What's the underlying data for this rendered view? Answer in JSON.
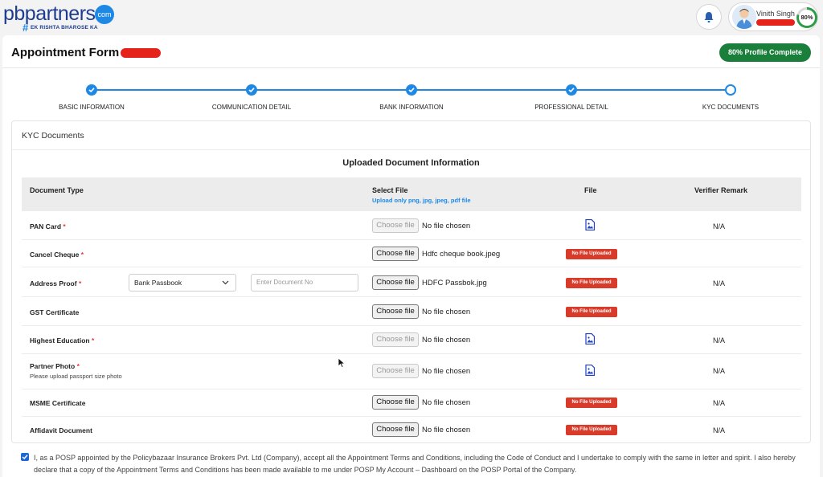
{
  "header": {
    "logo_main": "pbpartners",
    "logo_com": "com",
    "logo_tagline": "EK RISHTA BHAROSE KA",
    "user_name": "Vinith Singh",
    "profile_percent": "80%"
  },
  "form": {
    "title": "Appointment Form",
    "profile_button": "80% Profile Complete"
  },
  "steps": [
    {
      "label": "BASIC INFORMATION",
      "done": true
    },
    {
      "label": "COMMUNICATION DETAIL",
      "done": true
    },
    {
      "label": "BANK INFORMATION",
      "done": true
    },
    {
      "label": "PROFESSIONAL DETAIL",
      "done": true
    },
    {
      "label": "KYC DOCUMENTS",
      "done": false
    }
  ],
  "kyc": {
    "panel_title": "KYC Documents",
    "section_title": "Uploaded Document Information",
    "columns": {
      "document_type": "Document Type",
      "select_file": "Select File",
      "select_file_hint": "Upload only png, jpg, jpeg, pdf file",
      "file": "File",
      "verifier_remark": "Verifier Remark"
    },
    "choose_file_label": "Choose file",
    "no_file_badge": "No File Uploaded",
    "address_proof_select": "Bank Passbook",
    "doc_no_placeholder": "Enter Document No",
    "rows": [
      {
        "doc": "PAN Card",
        "required": "*",
        "file_name": "No file chosen",
        "remark": "N/A"
      },
      {
        "doc": "Cancel Cheque",
        "required": "*",
        "file_name": "Hdfc cheque book.jpeg",
        "remark": ""
      },
      {
        "doc": "Address Proof",
        "required": "*",
        "file_name": "HDFC Passbok.jpg",
        "remark": "N/A"
      },
      {
        "doc": "GST Certificate",
        "required": "",
        "file_name": "No file chosen",
        "remark": ""
      },
      {
        "doc": "Highest Education",
        "required": "*",
        "file_name": "No file chosen",
        "remark": "N/A"
      },
      {
        "doc": "Partner Photo",
        "required": "*",
        "sub": "Please upload passport size photo",
        "file_name": "No file chosen",
        "remark": "N/A"
      },
      {
        "doc": "MSME Certificate",
        "required": "",
        "file_name": "No file chosen",
        "remark": "N/A"
      },
      {
        "doc": "Affidavit Document",
        "required": "",
        "file_name": "No file chosen",
        "remark": "N/A"
      }
    ]
  },
  "declaration": {
    "checked": true,
    "text": "I, as a POSP appointed by the Policybazaar Insurance Brokers Pvt. Ltd (Company), accept all the Appointment Terms and Conditions, including the Code of Conduct and I undertake to comply with the same in letter and spirit. I also hereby declare that a copy of the Appointment Terms and Conditions has been made available to me under POSP My Account – Dashboard on the POSP Portal of the Company."
  },
  "colors": {
    "brand_blue": "#1d3c8f",
    "accent_blue": "#1e88e5",
    "success_green": "#1a7f3b",
    "error_red": "#d93b2b"
  }
}
